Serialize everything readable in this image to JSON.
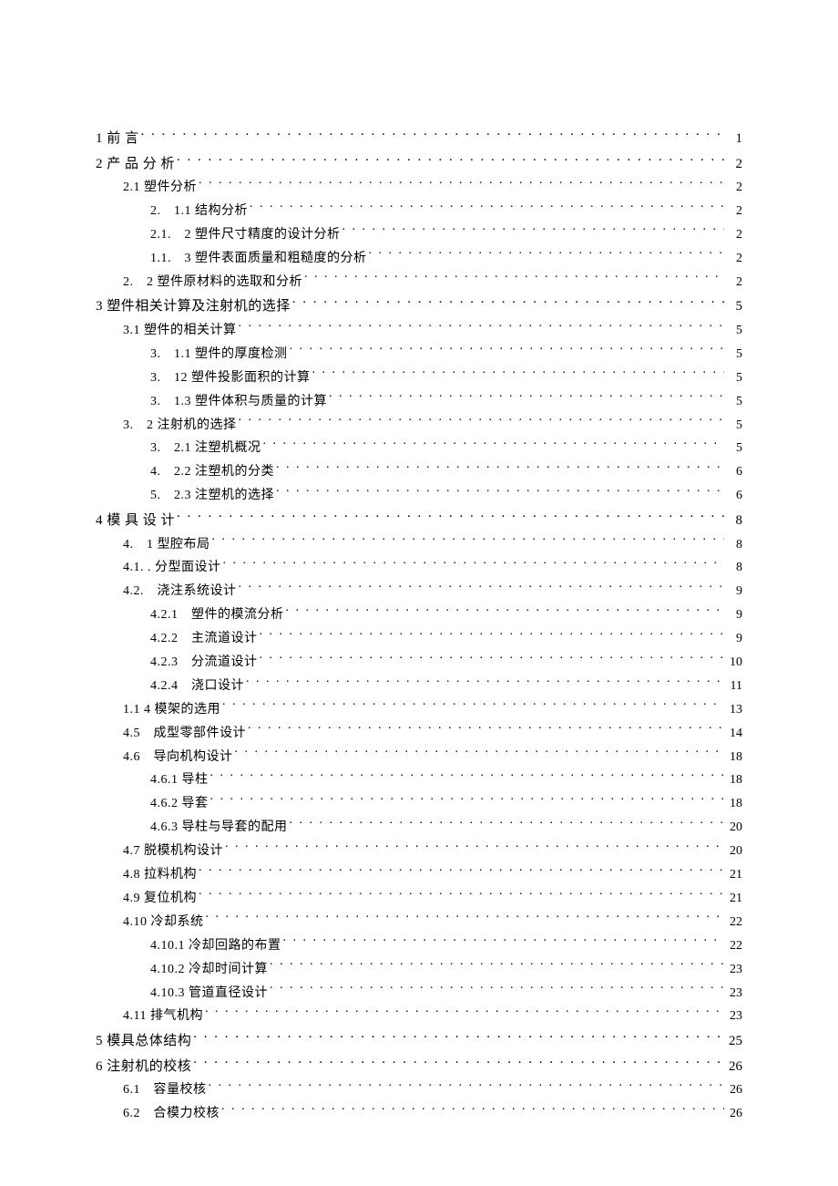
{
  "toc": [
    {
      "level": 0,
      "label": "1 前 言",
      "page": "1"
    },
    {
      "level": 0,
      "label": "2 产 品 分 析",
      "page": "2"
    },
    {
      "level": 1,
      "label": "2.1 塑件分析",
      "page": "2"
    },
    {
      "level": 2,
      "label": "2.　1.1 结构分析",
      "page": "2"
    },
    {
      "level": 2,
      "label": "2.1.　2 塑件尺寸精度的设计分析",
      "page": "2"
    },
    {
      "level": 2,
      "label": "1.1.　3 塑件表面质量和粗糙度的分析",
      "page": "2"
    },
    {
      "level": 1,
      "label": "2.　2 塑件原材料的选取和分析",
      "page": "2"
    },
    {
      "level": 0,
      "label": "3 塑件相关计算及注射机的选择",
      "page": "5"
    },
    {
      "level": 1,
      "label": "3.1 塑件的相关计算",
      "page": "5"
    },
    {
      "level": 2,
      "label": "3.　1.1 塑件的厚度检测",
      "page": "5"
    },
    {
      "level": 2,
      "label": "3.　12 塑件投影面积的计算",
      "page": "5"
    },
    {
      "level": 2,
      "label": "3.　1.3 塑件体积与质量的计算",
      "page": "5"
    },
    {
      "level": 1,
      "label": "3.　2 注射机的选择",
      "page": "5"
    },
    {
      "level": 2,
      "label": "3.　2.1 注塑机概况",
      "page": "5"
    },
    {
      "level": 2,
      "label": "4.　2.2 注塑机的分类",
      "page": "6"
    },
    {
      "level": 2,
      "label": "5.　2.3 注塑机的选择",
      "page": "6"
    },
    {
      "level": 0,
      "label": "4 模 具 设 计",
      "page": "8"
    },
    {
      "level": 1,
      "label": "4.　1 型腔布局",
      "page": "8"
    },
    {
      "level": 1,
      "label": "4.1.  . 分型面设计",
      "page": "8"
    },
    {
      "level": 1,
      "label": "4.2.　浇注系统设计",
      "page": "9"
    },
    {
      "level": 2,
      "label": "4.2.1　塑件的模流分析",
      "page": "9"
    },
    {
      "level": 2,
      "label": "4.2.2　主流道设计",
      "page": "9"
    },
    {
      "level": 2,
      "label": "4.2.3　分流道设计",
      "page": "10"
    },
    {
      "level": 2,
      "label": "4.2.4　浇口设计",
      "page": "11"
    },
    {
      "level": 1,
      "label": "1.1 4 模架的选用",
      "page": "13"
    },
    {
      "level": 1,
      "label": "4.5　成型零部件设计",
      "page": "14"
    },
    {
      "level": 1,
      "label": "4.6　导向机构设计",
      "page": "18"
    },
    {
      "level": 2,
      "label": "4.6.1 导柱",
      "page": "18"
    },
    {
      "level": 2,
      "label": "4.6.2 导套",
      "page": "18"
    },
    {
      "level": 2,
      "label": "4.6.3 导柱与导套的配用",
      "page": "20"
    },
    {
      "level": 1,
      "label": "4.7 脱模机构设计",
      "page": "20"
    },
    {
      "level": 1,
      "label": "4.8 拉料机构",
      "page": "21"
    },
    {
      "level": 1,
      "label": "4.9 复位机构",
      "page": "21"
    },
    {
      "level": 1,
      "label": "4.10 冷却系统",
      "page": "22"
    },
    {
      "level": 2,
      "label": "4.10.1 冷却回路的布置",
      "page": "22"
    },
    {
      "level": 2,
      "label": "4.10.2 冷却时间计算",
      "page": "23"
    },
    {
      "level": 2,
      "label": "4.10.3 管道直径设计",
      "page": "23"
    },
    {
      "level": 1,
      "label": "4.11 排气机构",
      "page": "23"
    },
    {
      "level": 0,
      "label": "5 模具总体结构",
      "page": "25"
    },
    {
      "level": 0,
      "label": "6 注射机的校核",
      "page": "26"
    },
    {
      "level": 1,
      "label": "6.1　容量校核",
      "page": "26"
    },
    {
      "level": 1,
      "label": "6.2　合模力校核",
      "page": "26"
    }
  ]
}
